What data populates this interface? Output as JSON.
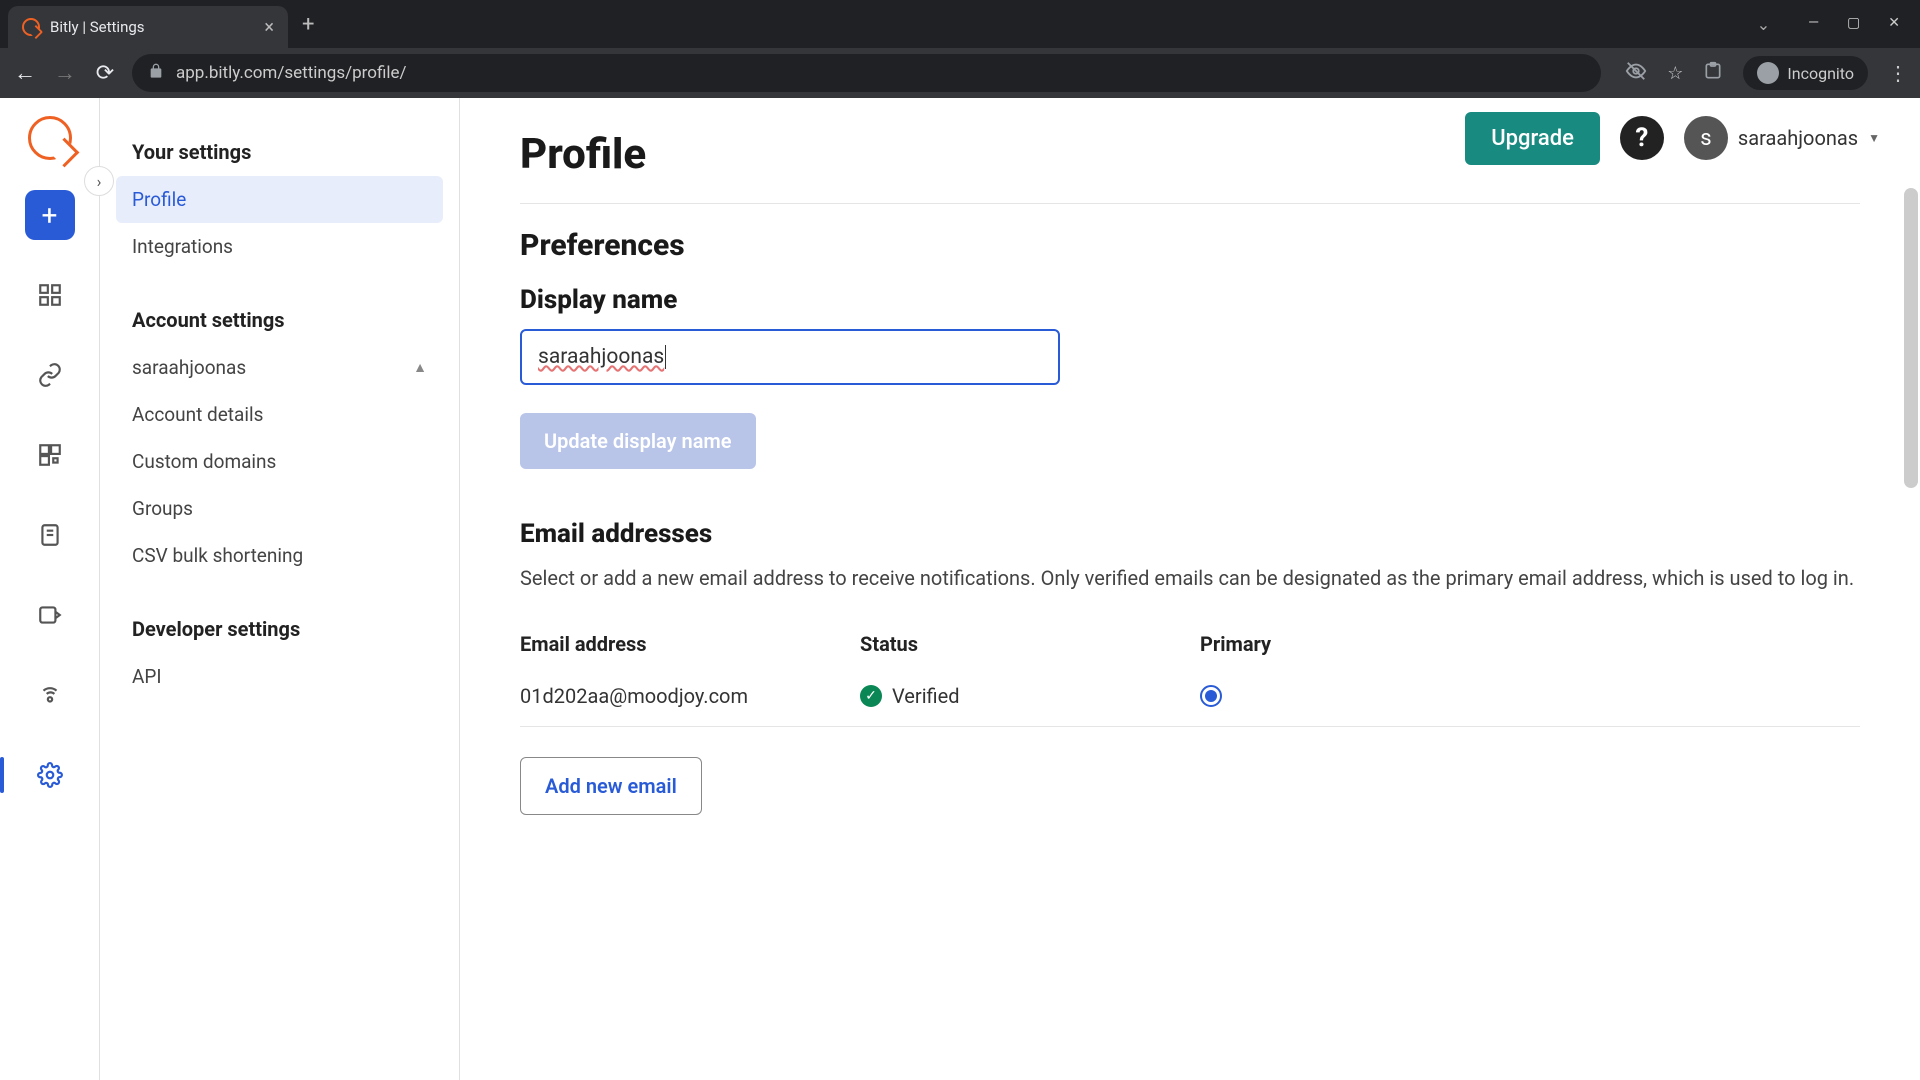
{
  "browser": {
    "tab_title": "Bitly | Settings",
    "url": "app.bitly.com/settings/profile/",
    "incognito_label": "Incognito"
  },
  "topbar": {
    "upgrade": "Upgrade",
    "username": "saraahjoonas",
    "avatar_initial": "s"
  },
  "sidebar": {
    "your_settings_heading": "Your settings",
    "your_settings": [
      {
        "label": "Profile"
      },
      {
        "label": "Integrations"
      }
    ],
    "account_settings_heading": "Account settings",
    "account_name": "saraahjoonas",
    "account_items": [
      {
        "label": "Account details"
      },
      {
        "label": "Custom domains"
      },
      {
        "label": "Groups"
      },
      {
        "label": "CSV bulk shortening"
      }
    ],
    "developer_heading": "Developer settings",
    "developer_items": [
      {
        "label": "API"
      }
    ]
  },
  "main": {
    "title": "Profile",
    "preferences_heading": "Preferences",
    "display_name_label": "Display name",
    "display_name_value": "saraahjoonas",
    "update_btn": "Update display name",
    "email_heading": "Email addresses",
    "email_desc": "Select or add a new email address to receive notifications. Only verified emails can be designated as the primary email address, which is used to log in.",
    "email_table": {
      "head_email": "Email address",
      "head_status": "Status",
      "head_primary": "Primary",
      "rows": [
        {
          "email": "01d202aa@moodjoy.com",
          "status": "Verified",
          "primary": true
        }
      ]
    },
    "add_email_btn": "Add new email"
  }
}
